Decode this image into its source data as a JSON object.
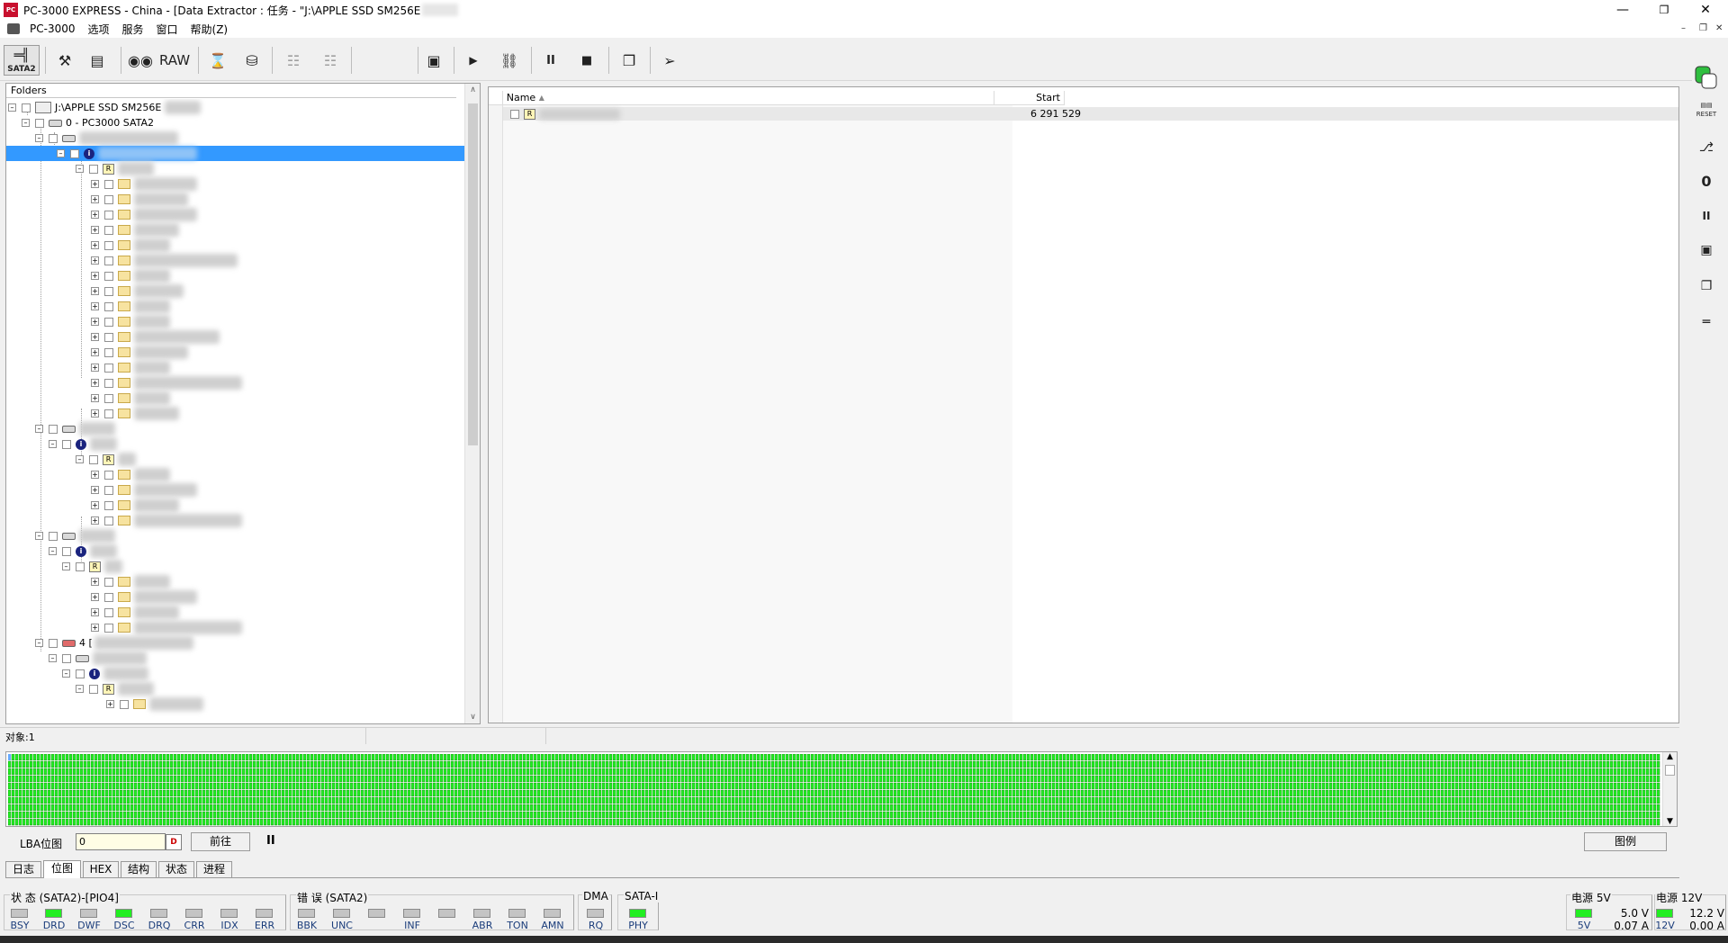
{
  "window": {
    "title": "PC-3000 EXPRESS - China - [Data Extractor : 任务 - \"J:\\APPLE SSD SM256E",
    "icon": "pc3000-app-icon"
  },
  "menu": {
    "items": [
      "PC-3000",
      "选项",
      "服务",
      "窗口",
      "帮助(Z)"
    ]
  },
  "toolbar": {
    "sata2_label": "SATA2",
    "raw_label": "RAW"
  },
  "tree": {
    "header": "Folders",
    "root_label": "J:\\APPLE SSD SM256E",
    "device_label": "0 - PC3000 SATA2",
    "partition4_label": "4 ["
  },
  "list": {
    "columns": [
      "Name",
      "Start"
    ],
    "rows": [
      {
        "name": "",
        "start": "6 291 529"
      }
    ]
  },
  "status_strip": {
    "objects": "对象:1"
  },
  "lba": {
    "label": "LBA位图",
    "value": "0",
    "goto_label": "前往",
    "pause_symbol": "II",
    "legend_label": "图例"
  },
  "tabs": [
    {
      "label": "日志",
      "active": false
    },
    {
      "label": "位图",
      "active": true
    },
    {
      "label": "HEX",
      "active": false
    },
    {
      "label": "结构",
      "active": false
    },
    {
      "label": "状态",
      "active": false
    },
    {
      "label": "进程",
      "active": false
    }
  ],
  "status_panel": {
    "state_title": "状 态 (SATA2)-[PIO4]",
    "state_leds": [
      {
        "label": "BSY",
        "on": false
      },
      {
        "label": "DRD",
        "on": true
      },
      {
        "label": "DWF",
        "on": false
      },
      {
        "label": "DSC",
        "on": true
      },
      {
        "label": "DRQ",
        "on": false
      },
      {
        "label": "CRR",
        "on": false
      },
      {
        "label": "IDX",
        "on": false
      },
      {
        "label": "ERR",
        "on": false
      }
    ],
    "error_title": "错 误 (SATA2)",
    "error_leds": [
      {
        "label": "BBK",
        "on": false
      },
      {
        "label": "UNC",
        "on": false
      },
      {
        "label": "",
        "on": false
      },
      {
        "label": "INF",
        "on": false
      },
      {
        "label": "",
        "on": false
      },
      {
        "label": "ABR",
        "on": false
      },
      {
        "label": "TON",
        "on": false
      },
      {
        "label": "AMN",
        "on": false
      }
    ],
    "dma_title": "DMA",
    "dma_led": {
      "label": "RQ",
      "on": false
    },
    "sata_title": "SATA-I",
    "sata_led": {
      "label": "PHY",
      "on": true
    },
    "power5_title": "电源 5V",
    "power5_led": {
      "label": "5V",
      "on": true
    },
    "power5_voltage": "5.0 V",
    "power5_current": "0.07 A",
    "power12_title": "电源 12V",
    "power12_led": {
      "label": "12V",
      "on": true
    },
    "power12_voltage": "12.2 V",
    "power12_current": "0.00 A"
  },
  "side_toolbar": {
    "reset_label": "RESET"
  },
  "colors": {
    "selection": "#3399ff",
    "bitmap_good": "#22ee22",
    "led_on": "#22ee22",
    "led_off": "#c4c4c4"
  }
}
